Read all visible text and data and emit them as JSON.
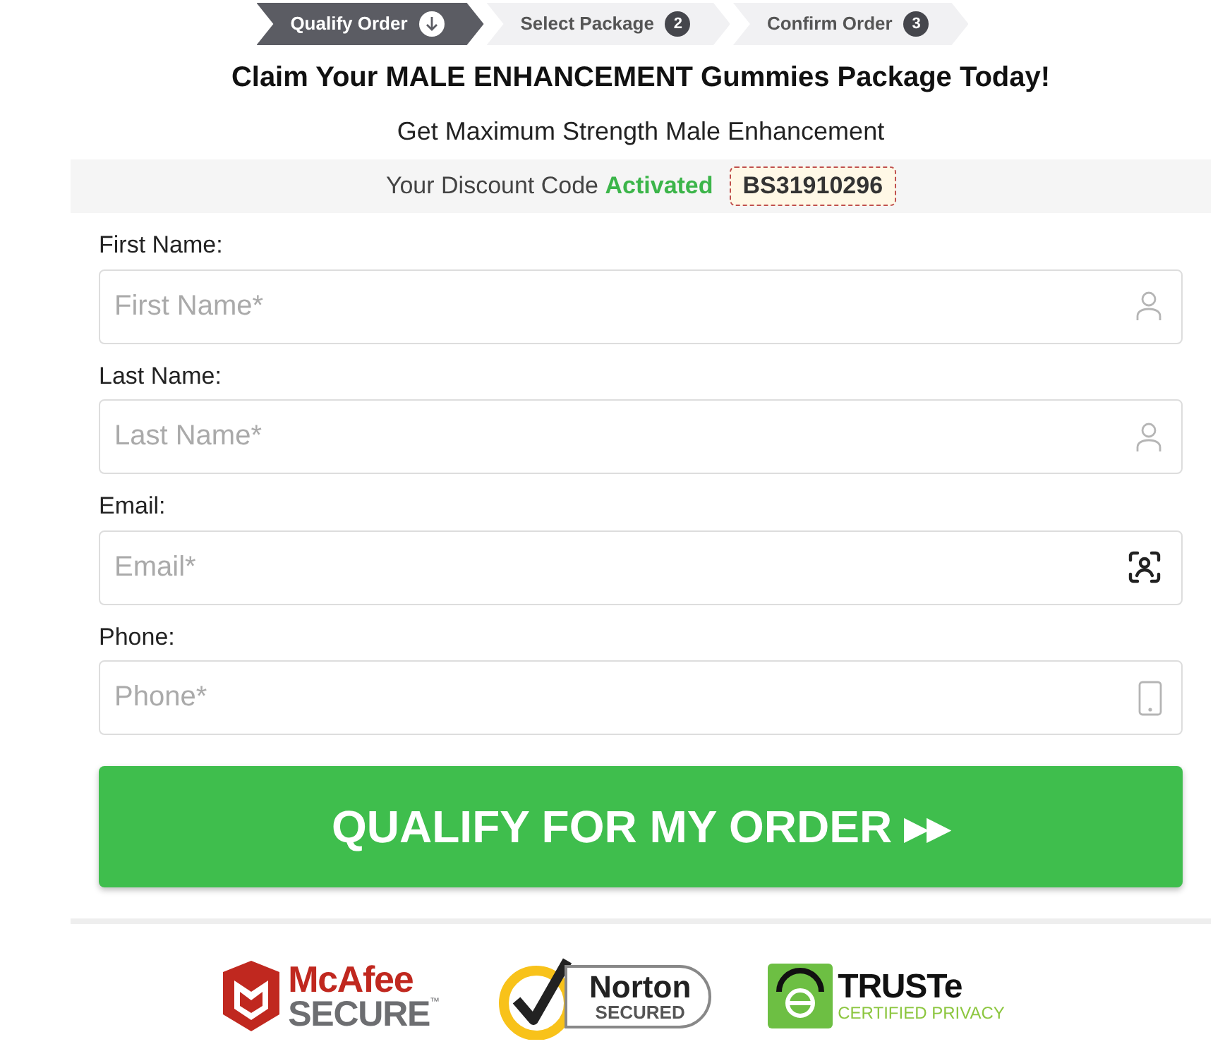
{
  "steps": [
    {
      "label": "Qualify Order",
      "selected": true
    },
    {
      "label": "Select Package",
      "selected": false,
      "badge": "2"
    },
    {
      "label": "Confirm Order",
      "selected": false,
      "badge": "3"
    }
  ],
  "title": "Claim Your MALE ENHANCEMENT Gummies Package Today!",
  "subtitle": "Get Maximum Strength Male Enhancement",
  "discount": {
    "text": "Your Discount Code",
    "status": "Activated",
    "code": "BS31910296"
  },
  "fields": [
    {
      "label": "First Name:",
      "placeholder": "First Name*",
      "kind": "name"
    },
    {
      "label": "Last Name:",
      "placeholder": "Last Name*",
      "kind": "name"
    },
    {
      "label": "Email:",
      "placeholder": "Email*",
      "kind": "email"
    },
    {
      "label": "Phone:",
      "placeholder": "Phone*",
      "kind": "phone"
    }
  ],
  "submit": "QUALIFY FOR MY ORDER ▸▸",
  "badges": [
    {
      "kind": "mcafee",
      "name": "McAfee",
      "sub": "SECURE",
      "mark": "™"
    },
    {
      "kind": "norton",
      "name": "Norton",
      "sub": "SECURED"
    },
    {
      "kind": "truste",
      "name": "TRUSTe",
      "sub": "CERTIFIED PRIVACY"
    }
  ]
}
